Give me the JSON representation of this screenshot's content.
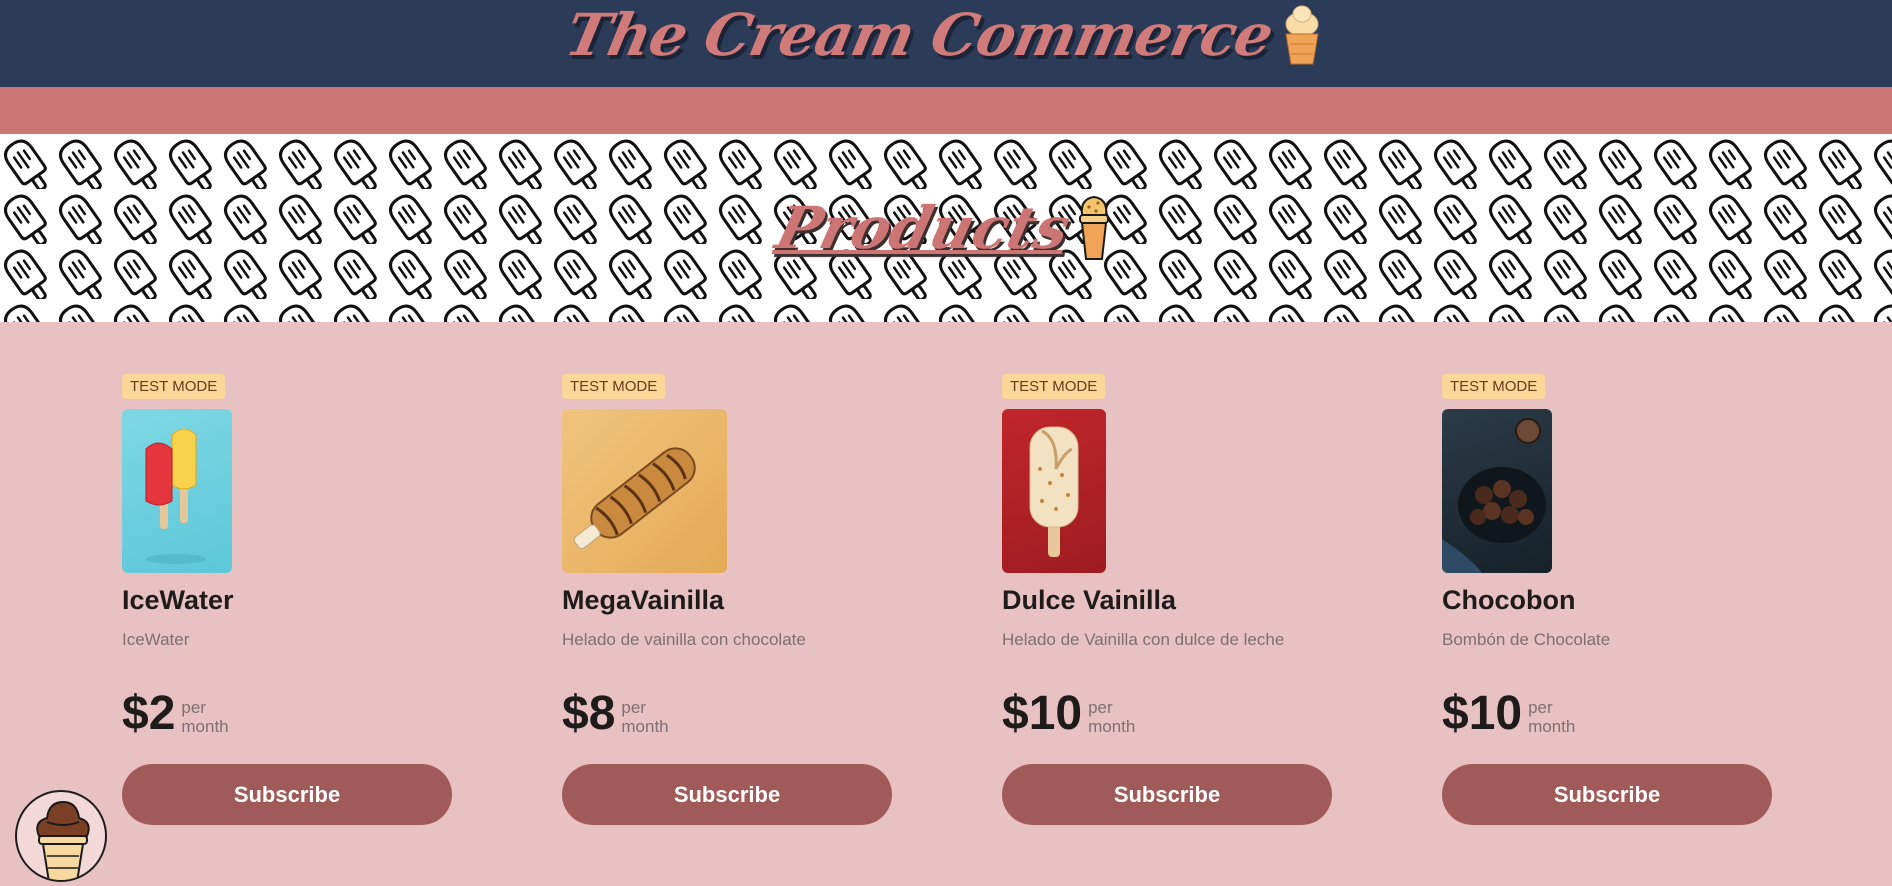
{
  "header": {
    "title": "The Cream Commerce"
  },
  "section": {
    "title": "Products"
  },
  "products": [
    {
      "badge": "TEST MODE",
      "name": "IceWater",
      "description": "IceWater",
      "price": "$2",
      "per_top": "per",
      "per_bottom": "month",
      "button": "Subscribe"
    },
    {
      "badge": "TEST MODE",
      "name": "MegaVainilla",
      "description": "Helado de vainilla con chocolate",
      "price": "$8",
      "per_top": "per",
      "per_bottom": "month",
      "button": "Subscribe"
    },
    {
      "badge": "TEST MODE",
      "name": "Dulce Vainilla",
      "description": "Helado de Vainilla con dulce de leche",
      "price": "$10",
      "per_top": "per",
      "per_bottom": "month",
      "button": "Subscribe"
    },
    {
      "badge": "TEST MODE",
      "name": "Chocobon",
      "description": "Bombón de Chocolate",
      "price": "$10",
      "per_top": "per",
      "per_bottom": "month",
      "button": "Subscribe"
    }
  ],
  "colors": {
    "navy": "#2c3b57",
    "rose": "#cd7474",
    "page": "#e8c2c3",
    "button": "#a15a5a",
    "badge": "#fbd89a"
  },
  "icons": [
    "ice-cream-cone-icon",
    "popsicle-pattern",
    "chocolate-cone-icon"
  ]
}
